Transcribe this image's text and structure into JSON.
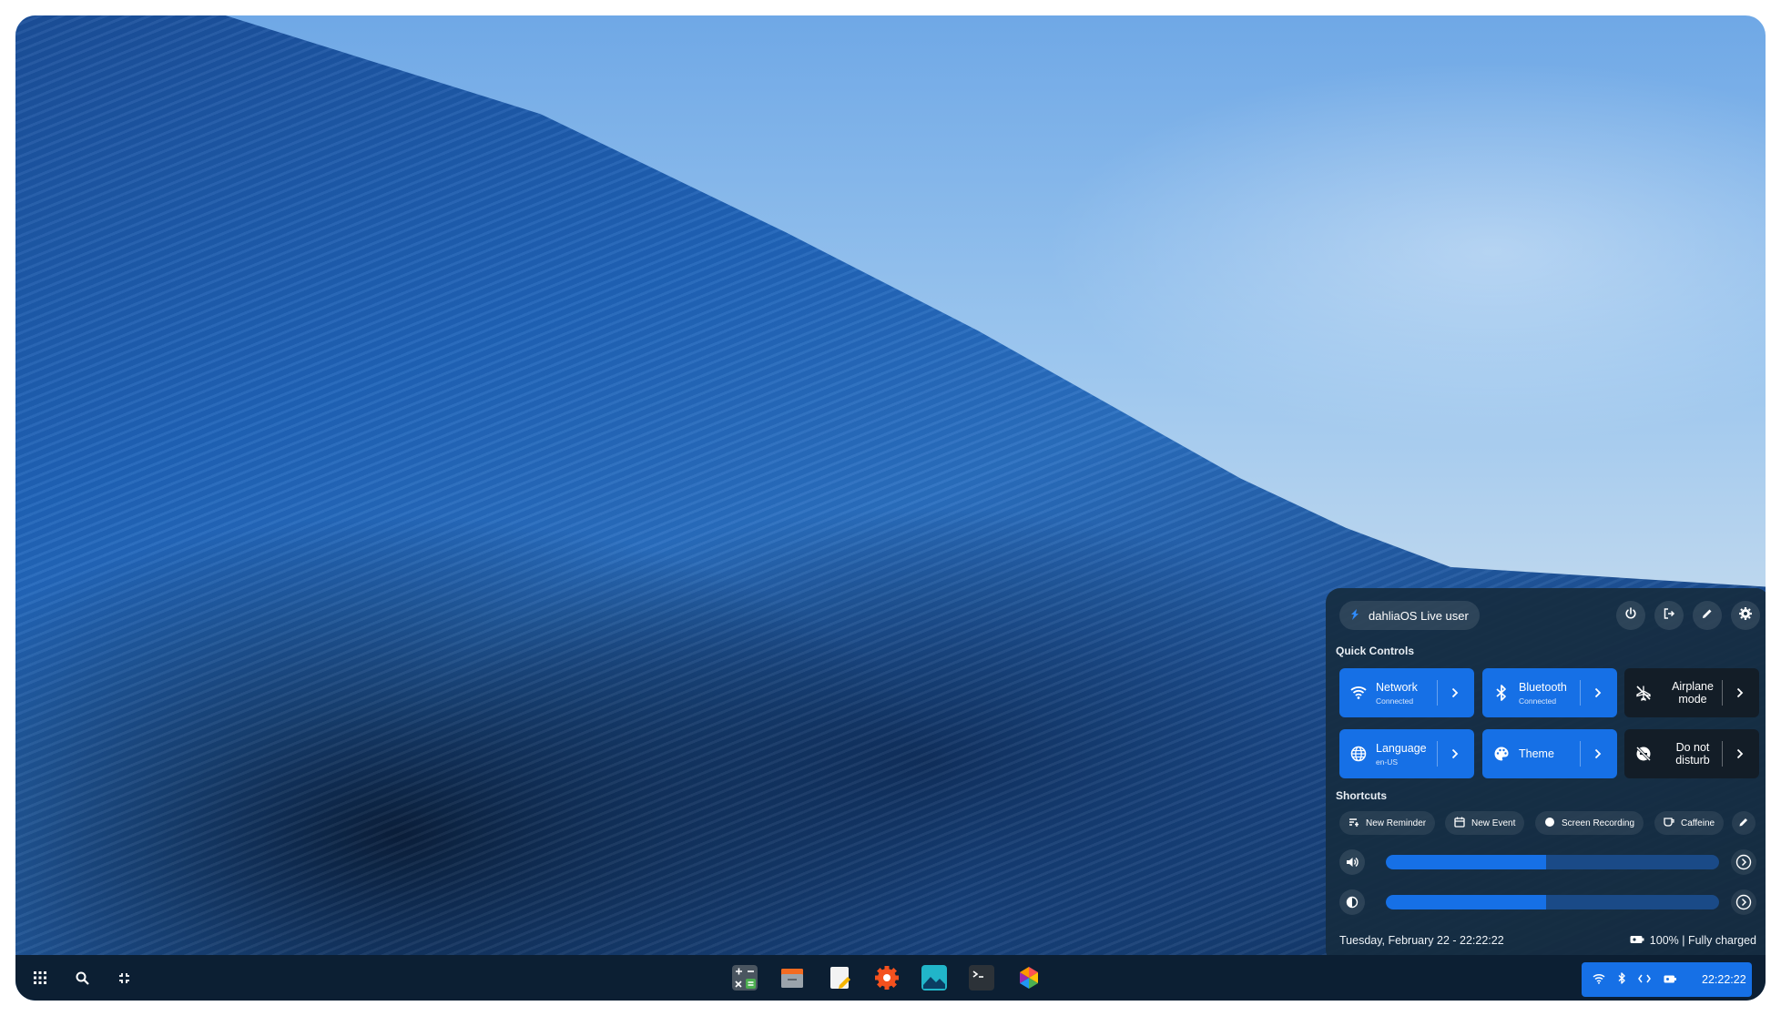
{
  "user_chip": {
    "label": "dahliaOS Live user",
    "icon": "dahlia-logo-icon"
  },
  "header_actions": [
    {
      "name": "power",
      "icon": "power-icon"
    },
    {
      "name": "logout",
      "icon": "logout-icon"
    },
    {
      "name": "edit",
      "icon": "pencil-icon"
    },
    {
      "name": "settings",
      "icon": "gear-icon"
    }
  ],
  "quick_controls": {
    "title": "Quick Controls",
    "tiles": [
      {
        "label": "Network",
        "sublabel": "Connected",
        "icon": "wifi-icon",
        "active": true
      },
      {
        "label": "Bluetooth",
        "sublabel": "Connected",
        "icon": "bluetooth-icon",
        "active": true
      },
      {
        "label": "Airplane mode",
        "sublabel": "",
        "icon": "airplane-off-icon",
        "active": false
      },
      {
        "label": "Language",
        "sublabel": "en-US",
        "icon": "globe-icon",
        "active": true
      },
      {
        "label": "Theme",
        "sublabel": "",
        "icon": "palette-icon",
        "active": true
      },
      {
        "label": "Do not disturb",
        "sublabel": "",
        "icon": "dnd-off-icon",
        "active": false
      }
    ]
  },
  "shortcuts": {
    "title": "Shortcuts",
    "items": [
      {
        "label": "New Reminder",
        "icon": "reminder-icon"
      },
      {
        "label": "New Event",
        "icon": "calendar-icon"
      },
      {
        "label": "Screen Recording",
        "icon": "record-icon"
      },
      {
        "label": "Caffeine",
        "icon": "coffee-icon"
      }
    ]
  },
  "sliders": {
    "volume": {
      "level": 0.48,
      "icon": "volume-icon"
    },
    "brightness": {
      "level": 0.48,
      "icon": "brightness-icon"
    }
  },
  "footer": {
    "datetime": "Tuesday, February 22 - 22:22:22",
    "battery": "100% | Fully charged"
  },
  "taskbar": {
    "left": [
      "app-grid-icon",
      "search-icon",
      "compress-icon"
    ],
    "apps": [
      "calculator",
      "files",
      "notes",
      "settings",
      "photos",
      "terminal",
      "store"
    ],
    "tray_time": "22:22:22",
    "accent": "#1670e6"
  }
}
